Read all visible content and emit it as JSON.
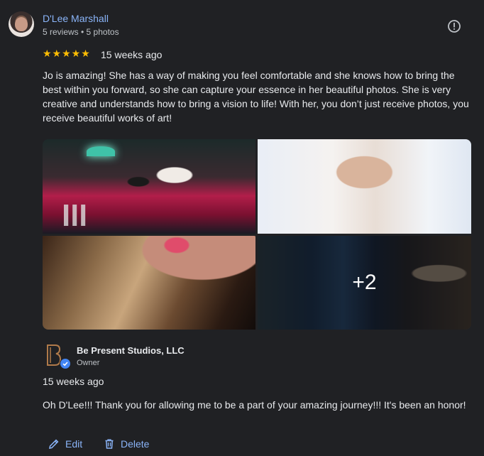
{
  "review": {
    "reviewer_name": "D'Lee Marshall",
    "reviewer_meta": "5 reviews • 5 photos",
    "stars": "★★★★★",
    "rating": 5,
    "time": "15 weeks ago",
    "text": "Jo is amazing! She has a way of making you feel comfortable and she knows how to bring the best within you forward, so she can capture your essence in her beautiful photos. She is very creative and understands how to bring a vision to life! With her, you don’t just receive photos, you receive beautiful works of art!"
  },
  "gallery": {
    "more_count": "+2"
  },
  "owner_reply": {
    "name": "Be Present Studios, LLC",
    "role": "Owner",
    "time": "15 weeks ago",
    "text": "Oh D'Lee!!! Thank you for allowing me to be a part of your amazing journey!!! It's been an honor!"
  },
  "actions": {
    "edit_label": "Edit",
    "delete_label": "Delete"
  },
  "icons": {
    "report": "alert-circle-icon",
    "edit": "pencil-icon",
    "delete": "trash-icon",
    "verified": "verified-check-icon"
  },
  "colors": {
    "background": "#202124",
    "link": "#8ab4f8",
    "star": "#fbbc04",
    "text": "#e8eaed",
    "secondary": "#bdc1c6",
    "verified": "#4285f4"
  }
}
